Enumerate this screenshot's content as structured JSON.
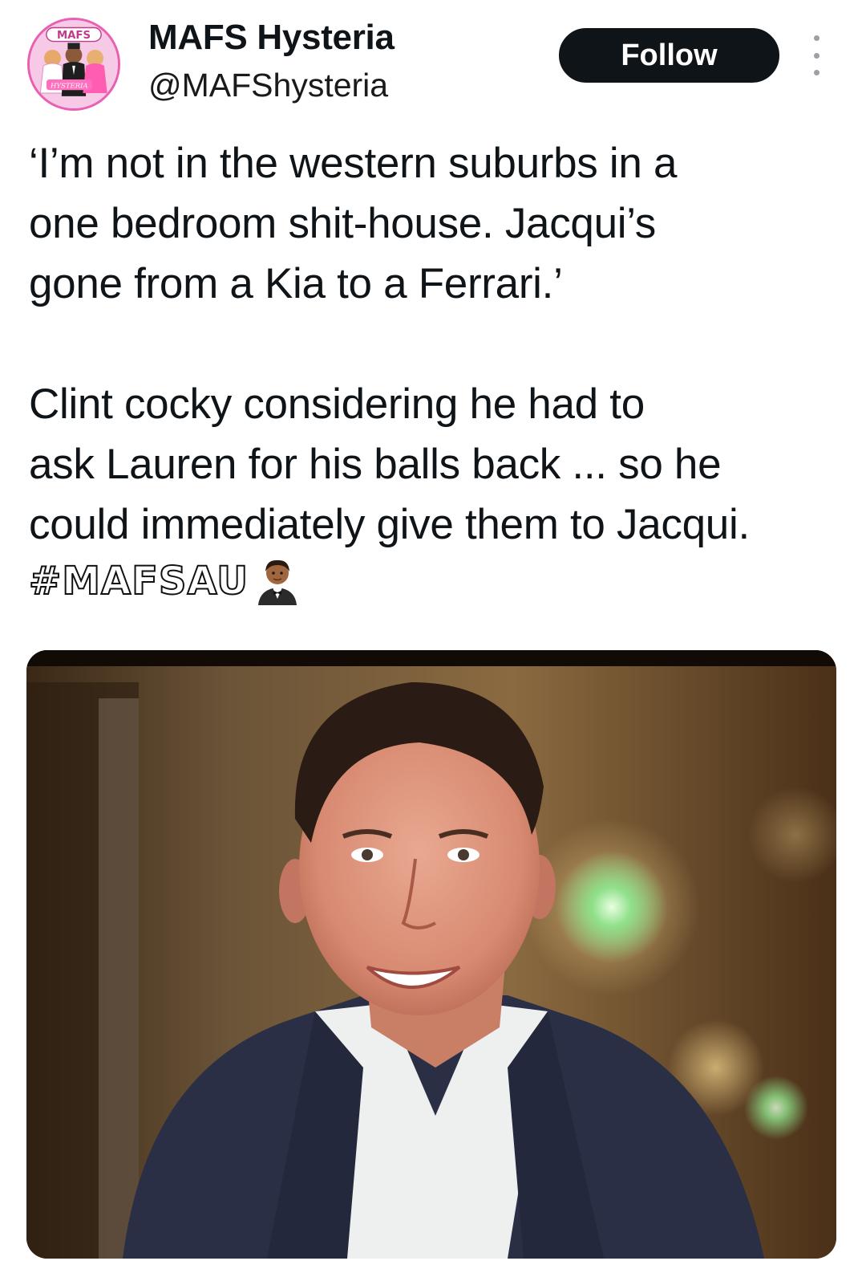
{
  "tweet": {
    "author": {
      "name": "MAFS Hysteria",
      "handle": "@MAFShysteria",
      "avatar": {
        "top_text": "MAFS",
        "bottom_text": "HYSTERIA",
        "background_color": "#f6c9e6",
        "accent_color": "#e85fb3"
      }
    },
    "follow_label": "Follow",
    "more_icon": "more-vertical-icon",
    "text_paragraphs": [
      "‘I’m not in the western suburbs in a\none bedroom shit-house. Jacqui’s\ngone from a Kia to a Ferrari.’",
      "Clint cocky considering he had to\nask Lauren for his balls back ... so he\ncould immediately give them to Jacqui."
    ],
    "hashtag": "#MAFSAU",
    "hashtag_emoji": "person-in-tuxedo-icon",
    "media": {
      "kind": "photo",
      "subject": "man-in-suit-icon"
    }
  },
  "colors": {
    "text": "#0f1419",
    "follow_bg": "#0f1419",
    "follow_text": "#ffffff",
    "secondary": "#9aa0a6"
  }
}
